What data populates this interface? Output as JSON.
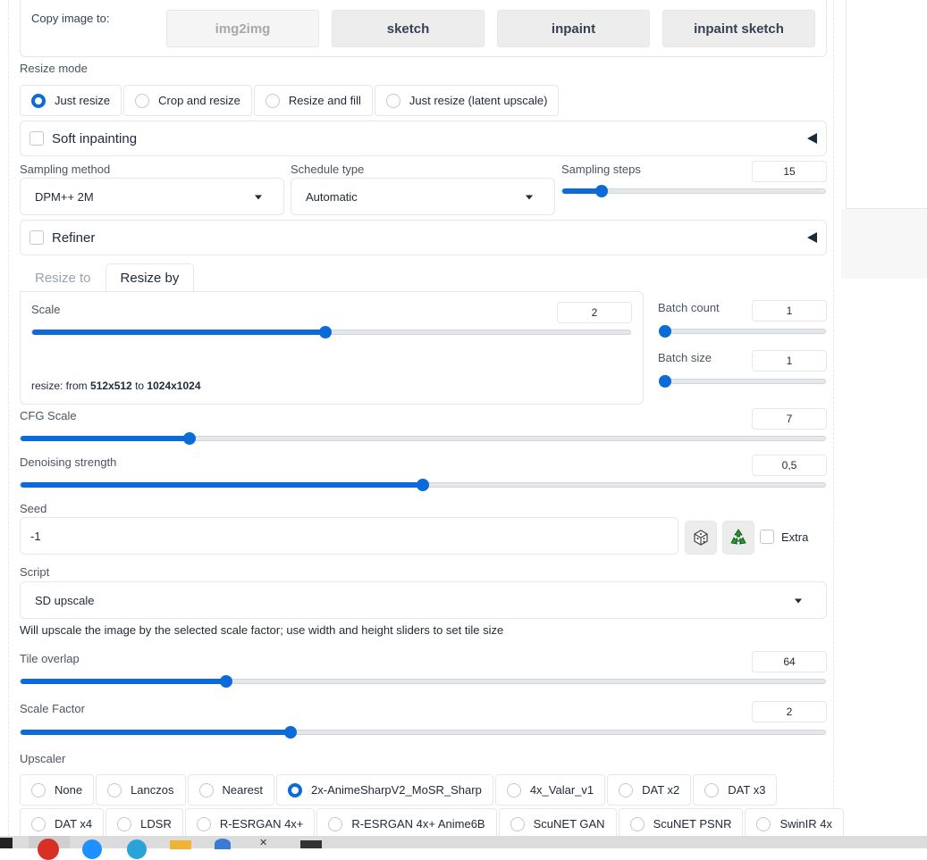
{
  "copy_image": {
    "label": "Copy image to:",
    "buttons": [
      "img2img",
      "sketch",
      "inpaint",
      "inpaint sketch"
    ]
  },
  "resize_mode": {
    "label": "Resize mode",
    "options": [
      "Just resize",
      "Crop and resize",
      "Resize and fill",
      "Just resize (latent upscale)"
    ],
    "selected": "Just resize"
  },
  "soft_inpainting": {
    "label": "Soft inpainting",
    "checked": false
  },
  "sampling": {
    "method_label": "Sampling method",
    "method_value": "DPM++ 2M",
    "schedule_label": "Schedule type",
    "schedule_value": "Automatic",
    "steps_label": "Sampling steps",
    "steps_value": "15",
    "steps_fraction": 0.15
  },
  "refiner": {
    "label": "Refiner",
    "checked": false
  },
  "resize_tabs": {
    "tabs": [
      "Resize to",
      "Resize by"
    ],
    "active": "Resize by"
  },
  "scale": {
    "label": "Scale",
    "value": "2",
    "fraction": 0.49,
    "note_prefix": "resize: from ",
    "note_from": "512x512",
    "note_mid": " to ",
    "note_to": "1024x1024"
  },
  "batch": {
    "count_label": "Batch count",
    "count_value": "1",
    "count_fraction": 0.0,
    "size_label": "Batch size",
    "size_value": "1",
    "size_fraction": 0.0
  },
  "cfg": {
    "label": "CFG Scale",
    "value": "7",
    "fraction": 0.21
  },
  "denoise": {
    "label": "Denoising strength",
    "value": "0,5",
    "fraction": 0.5
  },
  "seed": {
    "label": "Seed",
    "value": "-1",
    "extra_label": "Extra"
  },
  "script": {
    "label": "Script",
    "value": "SD upscale",
    "description": "Will upscale the image by the selected scale factor; use width and height sliders to set tile size"
  },
  "tile_overlap": {
    "label": "Tile overlap",
    "value": "64",
    "fraction": 0.255
  },
  "scale_factor": {
    "label": "Scale Factor",
    "value": "2",
    "fraction": 0.335
  },
  "upscaler": {
    "label": "Upscaler",
    "row1": [
      "None",
      "Lanczos",
      "Nearest",
      "2x-AnimeSharpV2_MoSR_Sharp",
      "4x_Valar_v1",
      "DAT x2",
      "DAT x3"
    ],
    "row2": [
      "DAT x4",
      "LDSR",
      "R-ESRGAN 4x+",
      "R-ESRGAN 4x+ Anime6B",
      "ScuNET GAN",
      "ScuNET PSNR",
      "SwinIR 4x"
    ],
    "selected": "2x-AnimeSharpV2_MoSR_Sharp"
  },
  "colors": {
    "accent": "#0b6bd8"
  }
}
